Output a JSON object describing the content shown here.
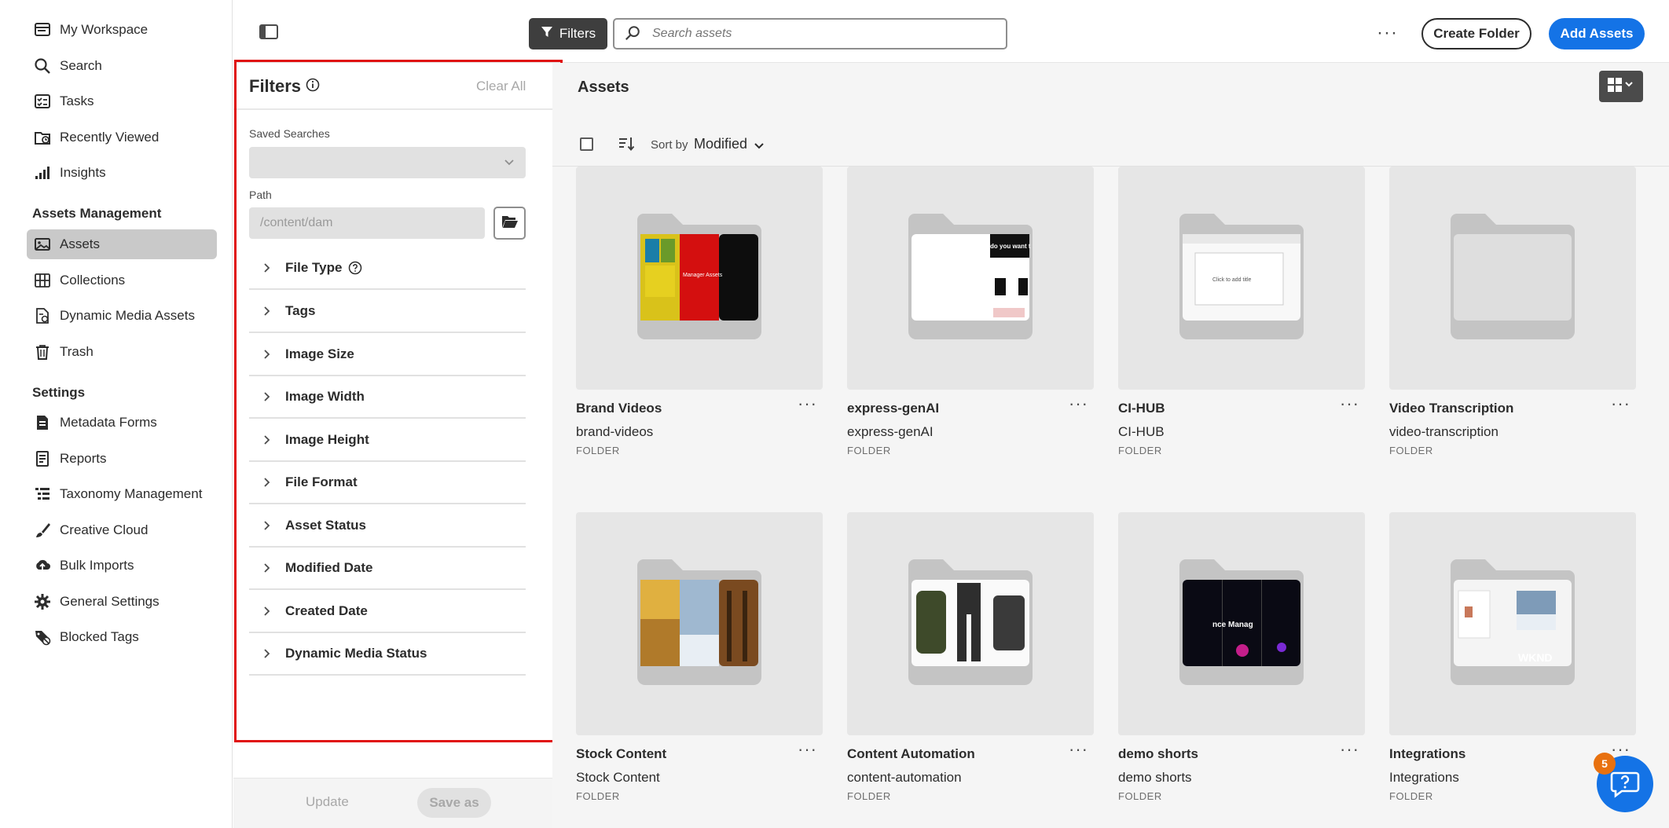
{
  "nav": {
    "items_top": [
      {
        "label": "My Workspace",
        "icon": "workspace-icon"
      },
      {
        "label": "Search",
        "icon": "search-icon"
      },
      {
        "label": "Tasks",
        "icon": "tasks-icon"
      },
      {
        "label": "Recently Viewed",
        "icon": "recently-viewed-icon"
      },
      {
        "label": "Insights",
        "icon": "insights-icon"
      }
    ],
    "section_assets": "Assets Management",
    "items_assets": [
      {
        "label": "Assets",
        "icon": "assets-icon",
        "active": true
      },
      {
        "label": "Collections",
        "icon": "collections-icon"
      },
      {
        "label": "Dynamic Media Assets",
        "icon": "dynamic-media-icon"
      },
      {
        "label": "Trash",
        "icon": "trash-icon"
      }
    ],
    "section_settings": "Settings",
    "items_settings": [
      {
        "label": "Metadata Forms",
        "icon": "metadata-forms-icon"
      },
      {
        "label": "Reports",
        "icon": "reports-icon"
      },
      {
        "label": "Taxonomy Management",
        "icon": "taxonomy-icon"
      },
      {
        "label": "Creative Cloud",
        "icon": "creative-cloud-icon"
      },
      {
        "label": "Bulk Imports",
        "icon": "bulk-imports-icon"
      },
      {
        "label": "General Settings",
        "icon": "gear-icon"
      },
      {
        "label": "Blocked Tags",
        "icon": "blocked-tags-icon"
      }
    ]
  },
  "topbar": {
    "filters_label": "Filters",
    "search_placeholder": "Search assets",
    "more_label": "···",
    "create_folder_label": "Create Folder",
    "add_assets_label": "Add Assets"
  },
  "filters": {
    "title": "Filters",
    "clear_all": "Clear All",
    "saved_searches_label": "Saved Searches",
    "saved_searches_value": "",
    "path_label": "Path",
    "path_placeholder": "/content/dam",
    "facets": [
      {
        "label": "File Type",
        "help": true
      },
      {
        "label": "Tags"
      },
      {
        "label": "Image Size"
      },
      {
        "label": "Image Width"
      },
      {
        "label": "Image Height"
      },
      {
        "label": "File Format"
      },
      {
        "label": "Asset Status"
      },
      {
        "label": "Modified Date"
      },
      {
        "label": "Created Date"
      },
      {
        "label": "Dynamic Media Status"
      }
    ],
    "update_label": "Update",
    "save_as_label": "Save as"
  },
  "assets": {
    "title": "Assets",
    "sort_by_label": "Sort by",
    "sort_by_value": "Modified",
    "cards": [
      {
        "name": "Brand Videos",
        "sub": "brand-videos",
        "type": "FOLDER",
        "preview": "brand"
      },
      {
        "name": "express-genAI",
        "sub": "express-genAI",
        "type": "FOLDER",
        "preview": "express"
      },
      {
        "name": "CI-HUB",
        "sub": "CI-HUB",
        "type": "FOLDER",
        "preview": "cihub"
      },
      {
        "name": "Video Transcription",
        "sub": "video-transcription",
        "type": "FOLDER",
        "preview": "empty"
      },
      {
        "name": "Stock Content",
        "sub": "Stock Content",
        "type": "FOLDER",
        "preview": "stock"
      },
      {
        "name": "Content Automation",
        "sub": "content-automation",
        "type": "FOLDER",
        "preview": "automation"
      },
      {
        "name": "demo shorts",
        "sub": "demo shorts",
        "type": "FOLDER",
        "preview": "shorts"
      },
      {
        "name": "Integrations",
        "sub": "Integrations",
        "type": "FOLDER",
        "preview": "integrations"
      }
    ],
    "preview_text": {
      "brand": "Manager Assets",
      "express": "do you want t",
      "cihub": "Click to add title",
      "shorts": "nce Manag",
      "integrations": "WKND"
    }
  },
  "help": {
    "badge": "5"
  },
  "colors": {
    "accent": "#1473e6",
    "highlight": "#e01010",
    "badge": "#e8710f"
  }
}
